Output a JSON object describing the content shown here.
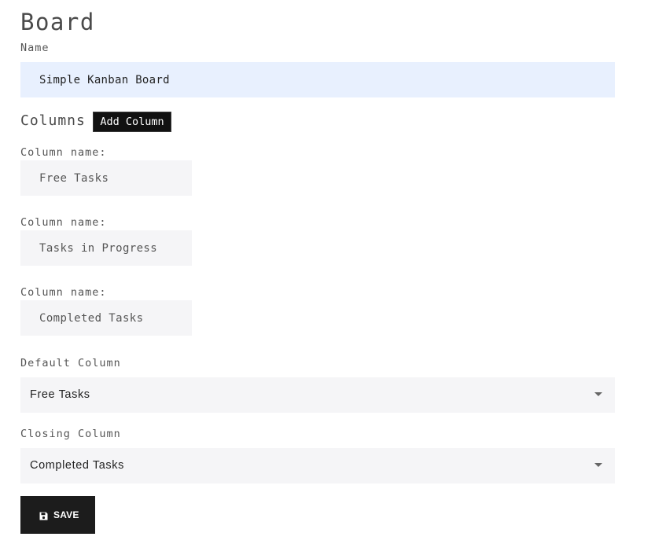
{
  "page": {
    "title": "Board"
  },
  "board": {
    "name_label": "Name",
    "name_value": "Simple Kanban Board"
  },
  "columns_section": {
    "heading": "Columns",
    "add_button_label": "Add Column",
    "items": [
      {
        "label": "Column name:",
        "value": "Free Tasks"
      },
      {
        "label": "Column name:",
        "value": "Tasks in Progress"
      },
      {
        "label": "Column name:",
        "value": "Completed Tasks"
      }
    ]
  },
  "default_column": {
    "label": "Default Column",
    "selected": "Free Tasks"
  },
  "closing_column": {
    "label": "Closing Column",
    "selected": "Completed Tasks"
  },
  "actions": {
    "save_label": "SAVE",
    "save_icon": "floppy-disk-icon"
  },
  "colors": {
    "name_input_bg": "#e8f0fe",
    "input_bg": "#f5f5f7",
    "button_bg": "#1c1c1c"
  }
}
